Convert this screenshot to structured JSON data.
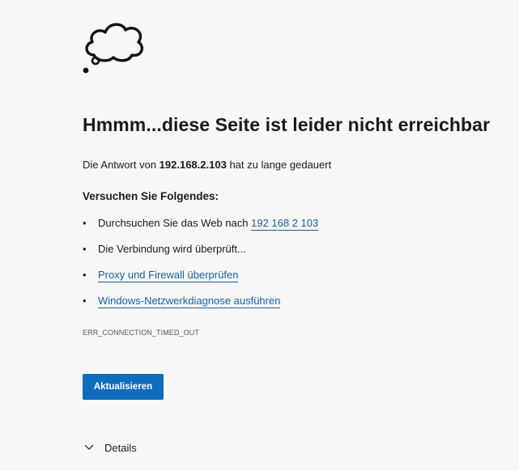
{
  "page": {
    "icon": "thought-bubble-icon",
    "title": "Hmmm...diese Seite ist leider nicht erreichbar",
    "response": {
      "prefix": "Die Antwort von",
      "host": "192.168.2.103",
      "suffix": "hat zu lange gedauert"
    },
    "try_heading": "Versuchen Sie Folgendes:",
    "suggestions": [
      {
        "prefix": "Durchsuchen Sie das Web nach",
        "link": "192 168 2 103"
      },
      {
        "text": "Die Verbindung wird überprüft..."
      },
      {
        "link": "Proxy und Firewall überprüfen"
      },
      {
        "link": "Windows-Netzwerkdiagnose ausführen"
      }
    ],
    "bullet": "•",
    "error_code": "ERR_CONNECTION_TIMED_OUT",
    "refresh_label": "Aktualisieren",
    "details_label": "Details",
    "details_icon": "chevron-down-icon"
  },
  "colors": {
    "background": "#f7f7f7",
    "text": "#1b1b1b",
    "link": "#185f9a",
    "button": "#0f6cbd",
    "button_text": "#ffffff"
  }
}
